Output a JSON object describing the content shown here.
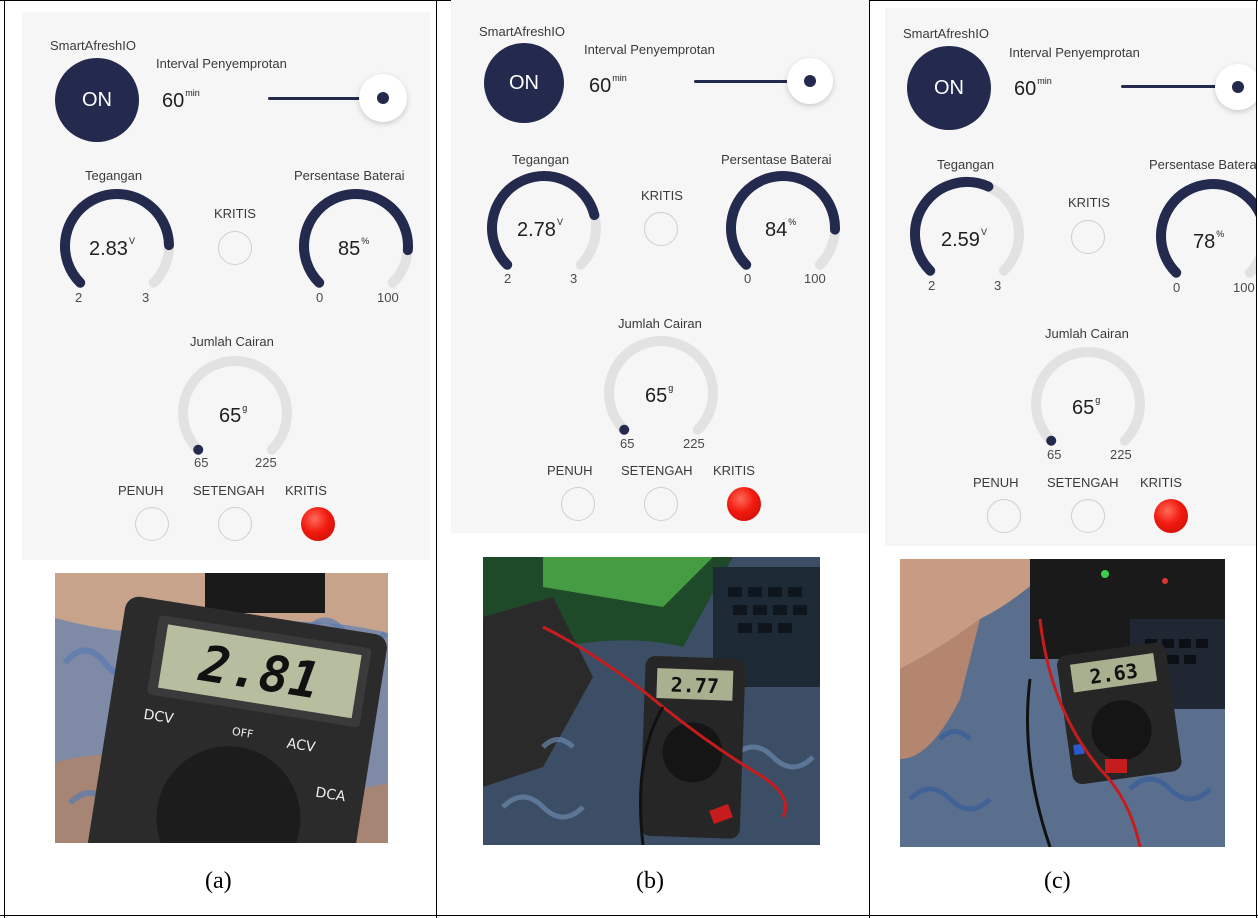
{
  "app": {
    "title": "SmartAfreshIO",
    "power_label": "ON",
    "interval_label": "Interval Penyemprotan",
    "interval_value": "60",
    "interval_unit": "min",
    "voltage_label": "Tegangan",
    "voltage_unit": "V",
    "voltage_min": "2",
    "voltage_max": "3",
    "battery_label": "Persentase Baterai",
    "battery_unit": "%",
    "battery_min": "0",
    "battery_max": "100",
    "critical_label": "KRITIS",
    "liquid_label": "Jumlah Cairan",
    "liquid_value": "65",
    "liquid_unit": "g",
    "liquid_min": "65",
    "liquid_max": "225",
    "level_full": "PENUH",
    "level_half": "SETENGAH",
    "level_critical": "KRITIS"
  },
  "panels": [
    {
      "caption": "(a)",
      "voltage": "2.83",
      "battery": "85",
      "meter_reading": "2.81",
      "voltage_fraction": 0.83,
      "battery_fraction": 0.85,
      "liquid_fraction": 0.0
    },
    {
      "caption": "(b)",
      "voltage": "2.78",
      "battery": "84",
      "meter_reading": "2.77",
      "voltage_fraction": 0.78,
      "battery_fraction": 0.84,
      "liquid_fraction": 0.0
    },
    {
      "caption": "(c)",
      "voltage": "2.59",
      "battery": "78",
      "meter_reading": "2.63",
      "voltage_fraction": 0.59,
      "battery_fraction": 0.78,
      "liquid_fraction": 0.0
    }
  ],
  "meter_labels": {
    "dcv": "DCV",
    "acv": "ACV",
    "dca": "DCA",
    "off": "OFF"
  },
  "colors": {
    "accent": "#232a4e",
    "track": "#e2e2e2",
    "alert": "#f11a0e",
    "screen_bg": "#f6f6f6"
  }
}
